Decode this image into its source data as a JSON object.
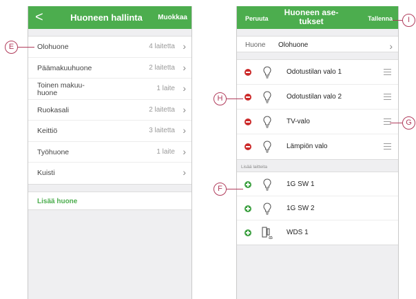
{
  "left_screen": {
    "header": {
      "back_symbol": "<",
      "title": "Huoneen hallinta",
      "edit_label": "Muokkaa"
    },
    "rooms": [
      {
        "name": "Olohuone",
        "count": "4 laitetta"
      },
      {
        "name": "Päämakuuhuone",
        "count": "2 laitetta"
      },
      {
        "name": "Toinen makuu-huone",
        "count": "1 laite"
      },
      {
        "name": "Ruokasali",
        "count": "2 laitetta"
      },
      {
        "name": "Keittiö",
        "count": "3 laitetta"
      },
      {
        "name": "Työhuone",
        "count": "1 laite"
      },
      {
        "name": "Kuisti",
        "count": ""
      }
    ],
    "add_room_label": "Lisää huone"
  },
  "right_screen": {
    "header": {
      "cancel_label": "Peruuta",
      "title": "Huoneen ase-tukset",
      "save_label": "Tallenna"
    },
    "room_field": {
      "label": "Huone",
      "value": "Olohuone"
    },
    "assigned_devices": [
      {
        "name": "Odotustilan valo 1",
        "icon": "bulb-icon"
      },
      {
        "name": "Odotustilan valo 2",
        "icon": "bulb-icon"
      },
      {
        "name": "TV-valo",
        "icon": "bulb-icon"
      },
      {
        "name": "Lämpiön valo",
        "icon": "bulb-icon"
      }
    ],
    "add_devices_label": "Lisää laitteita",
    "available_devices": [
      {
        "name": "1G SW 1",
        "icon": "bulb-icon"
      },
      {
        "name": "1G SW 2",
        "icon": "bulb-icon"
      },
      {
        "name": "WDS 1",
        "icon": "door-sensor-icon"
      }
    ]
  },
  "callouts": {
    "e": "E",
    "h": "H",
    "f": "F",
    "g": "G",
    "i": "I"
  },
  "colors": {
    "accent": "#4cad4e",
    "remove": "#cc2a2a",
    "add": "#3fa143",
    "callout": "#b03a5a"
  }
}
